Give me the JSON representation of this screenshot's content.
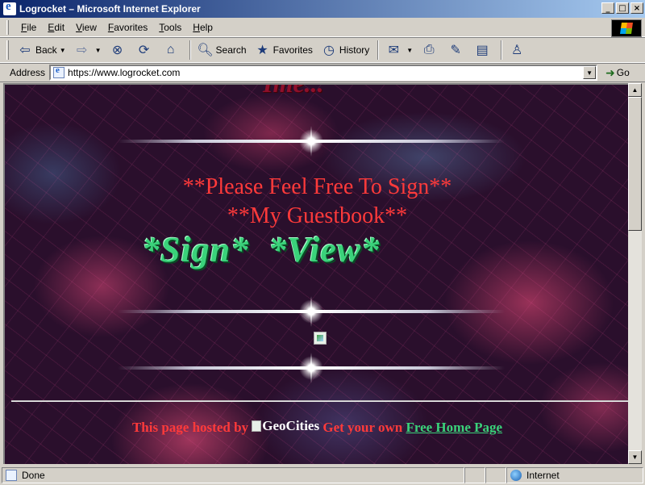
{
  "window": {
    "title": "Logrocket – Microsoft Internet Explorer",
    "controls": [
      "_",
      "□",
      "×"
    ]
  },
  "menu": [
    "File",
    "Edit",
    "View",
    "Favorites",
    "Tools",
    "Help"
  ],
  "toolbar": {
    "back": "Back",
    "search": "Search",
    "favorites": "Favorites",
    "history": "History"
  },
  "address": {
    "label": "Address",
    "url": "https://www.logrocket.com",
    "go": "Go"
  },
  "page": {
    "heading_partial": "Ime...",
    "sign_line1": "**Please Feel Free To Sign**",
    "sign_line2": "**My Guestbook**",
    "sign_link": "*Sign*",
    "view_link": "*View*",
    "footer_prefix": "This page hosted by",
    "geocities_alt": "GeoCities",
    "footer_mid": "Get your own",
    "free_home_page": "Free Home Page"
  },
  "status": {
    "text": "Done",
    "zone": "Internet"
  },
  "colors": {
    "title_bar": "#0a246a",
    "page_text": "#ff3a3a",
    "link_green": "#3ad27a",
    "background": "#2a0f2c"
  }
}
